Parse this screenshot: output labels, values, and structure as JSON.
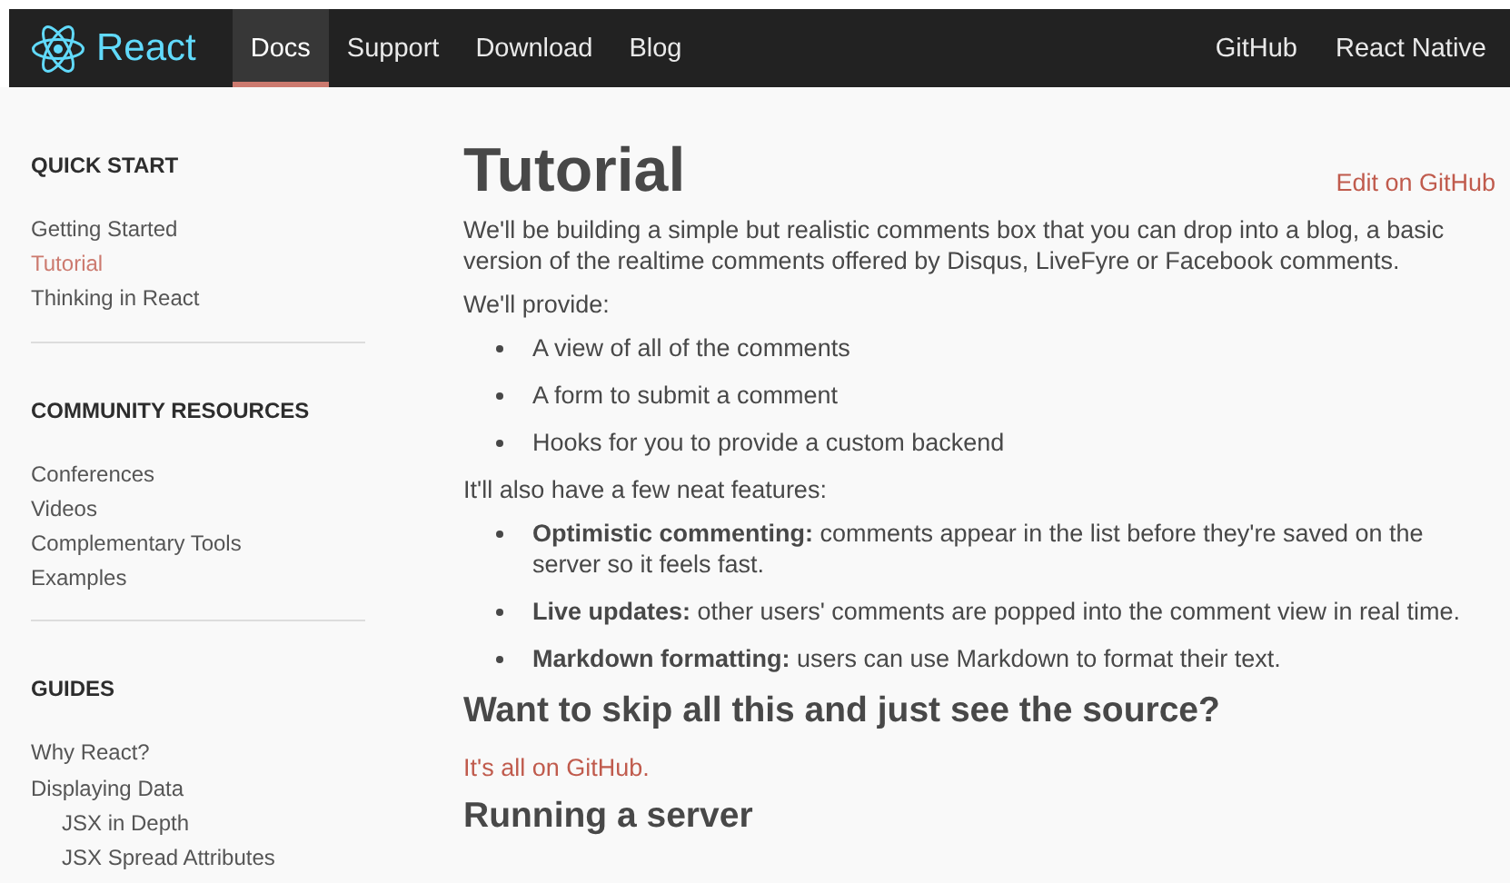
{
  "header": {
    "logo": "React",
    "nav": [
      {
        "label": "Docs",
        "selected": true
      },
      {
        "label": "Support",
        "selected": false
      },
      {
        "label": "Download",
        "selected": false
      },
      {
        "label": "Blog",
        "selected": false
      }
    ],
    "nav_right": [
      {
        "label": "GitHub"
      },
      {
        "label": "React Native"
      }
    ]
  },
  "sidebar": {
    "sections": [
      {
        "title": "QUICK START",
        "items": [
          {
            "label": "Getting Started",
            "selected": false
          },
          {
            "label": "Tutorial",
            "selected": true
          },
          {
            "label": "Thinking in React",
            "selected": false
          }
        ]
      },
      {
        "title": "COMMUNITY RESOURCES",
        "items": [
          {
            "label": "Conferences",
            "selected": false
          },
          {
            "label": "Videos",
            "selected": false
          },
          {
            "label": "Complementary Tools",
            "selected": false
          },
          {
            "label": "Examples",
            "selected": false
          }
        ]
      },
      {
        "title": "GUIDES",
        "items": [
          {
            "label": "Why React?",
            "selected": false
          },
          {
            "label": "Displaying Data",
            "selected": false,
            "children": [
              {
                "label": "JSX in Depth",
                "selected": false
              },
              {
                "label": "JSX Spread Attributes",
                "selected": false
              }
            ]
          }
        ]
      }
    ]
  },
  "content": {
    "title": "Tutorial",
    "edit_link": "Edit on GitHub",
    "blocks": [
      {
        "kind": "paragraph",
        "text": "We'll be building a simple but realistic comments box that you can drop into a blog, a basic version of the realtime comments offered by Disqus, LiveFyre or Facebook comments."
      },
      {
        "kind": "paragraph",
        "text": "We'll provide:"
      },
      {
        "kind": "list",
        "items": [
          "A view of all of the comments",
          "A form to submit a comment",
          "Hooks for you to provide a custom backend"
        ]
      },
      {
        "kind": "paragraph",
        "text": "It'll also have a few neat features:"
      },
      {
        "kind": "list",
        "items": [
          "**Optimistic commenting:** comments appear in the list before they're saved on the server so it feels fast.",
          "**Live updates:** other users' comments are popped into the comment view in real time.",
          "**Markdown formatting:** users can use Markdown to format their text."
        ]
      },
      {
        "kind": "heading",
        "text": "Want to skip all this and just see the source?"
      },
      {
        "kind": "link",
        "text": "It's all on GitHub."
      },
      {
        "kind": "heading",
        "text": "Running a server"
      }
    ]
  }
}
